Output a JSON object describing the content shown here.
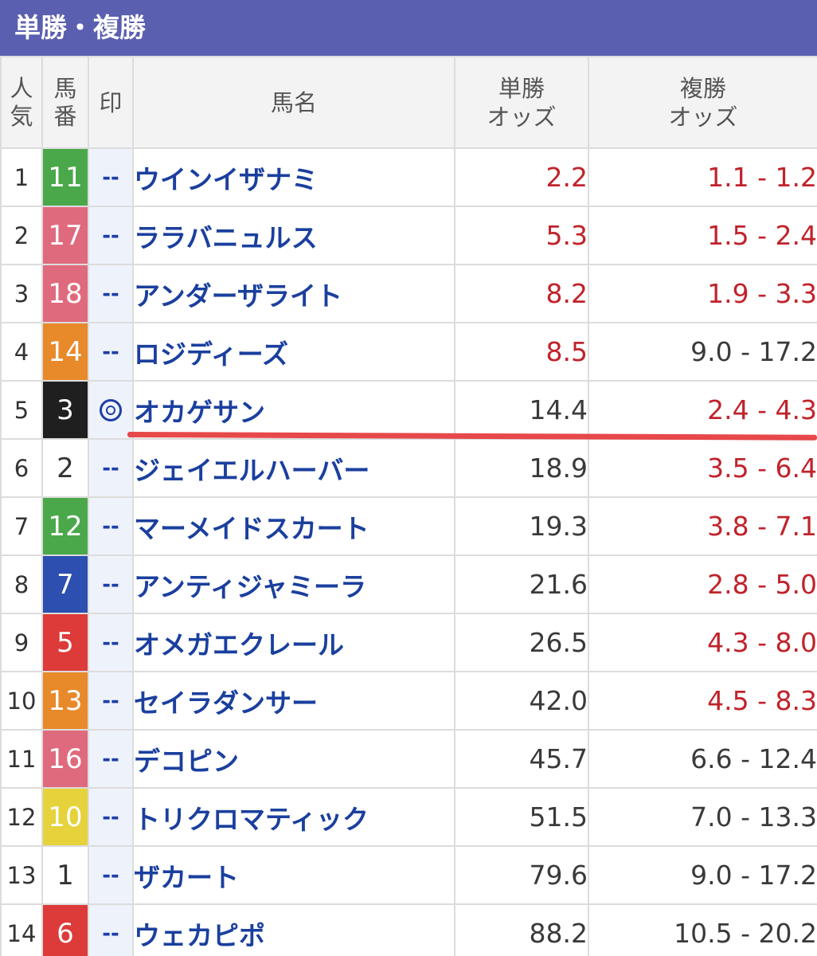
{
  "section_title": "単勝・複勝",
  "headers": {
    "rank": "人気",
    "number": "馬番",
    "mark": "印",
    "name": "馬名",
    "win_odds": [
      "単勝",
      "オッズ"
    ],
    "place_odds": [
      "複勝",
      "オッズ"
    ]
  },
  "rows": [
    {
      "rank": "1",
      "number": "11",
      "number_bg": "#4aa84a",
      "mark": "--",
      "name": "ウインイザナミ",
      "win": "2.2",
      "win_hot": true,
      "place": "1.1 - 1.2",
      "place_hot": true
    },
    {
      "rank": "2",
      "number": "17",
      "number_bg": "#e06a7d",
      "mark": "--",
      "name": "ララバニュルス",
      "win": "5.3",
      "win_hot": true,
      "place": "1.5 - 2.4",
      "place_hot": true
    },
    {
      "rank": "3",
      "number": "18",
      "number_bg": "#e06a7d",
      "mark": "--",
      "name": "アンダーザライト",
      "win": "8.2",
      "win_hot": true,
      "place": "1.9 - 3.3",
      "place_hot": true
    },
    {
      "rank": "4",
      "number": "14",
      "number_bg": "#e8892a",
      "mark": "--",
      "name": "ロジディーズ",
      "win": "8.5",
      "win_hot": true,
      "place": "9.0 - 17.2",
      "place_hot": false
    },
    {
      "rank": "5",
      "number": "3",
      "number_bg": "#1f1f1f",
      "mark": "◎",
      "name": "オカゲサン",
      "win": "14.4",
      "win_hot": false,
      "place": "2.4 - 4.3",
      "place_hot": true
    },
    {
      "rank": "6",
      "number": "2",
      "number_bg": "#ffffff",
      "mark": "--",
      "name": "ジェイエルハーバー",
      "win": "18.9",
      "win_hot": false,
      "place": "3.5 - 6.4",
      "place_hot": true
    },
    {
      "rank": "7",
      "number": "12",
      "number_bg": "#4aa84a",
      "mark": "--",
      "name": "マーメイドスカート",
      "win": "19.3",
      "win_hot": false,
      "place": "3.8 - 7.1",
      "place_hot": true
    },
    {
      "rank": "8",
      "number": "7",
      "number_bg": "#2c4fb0",
      "mark": "--",
      "name": "アンティジャミーラ",
      "win": "21.6",
      "win_hot": false,
      "place": "2.8 - 5.0",
      "place_hot": true
    },
    {
      "rank": "9",
      "number": "5",
      "number_bg": "#dd3a3a",
      "mark": "--",
      "name": "オメガエクレール",
      "win": "26.5",
      "win_hot": false,
      "place": "4.3 - 8.0",
      "place_hot": true
    },
    {
      "rank": "10",
      "number": "13",
      "number_bg": "#e8892a",
      "mark": "--",
      "name": "セイラダンサー",
      "win": "42.0",
      "win_hot": false,
      "place": "4.5 - 8.3",
      "place_hot": true
    },
    {
      "rank": "11",
      "number": "16",
      "number_bg": "#e06a7d",
      "mark": "--",
      "name": "デコピン",
      "win": "45.7",
      "win_hot": false,
      "place": "6.6 - 12.4",
      "place_hot": false
    },
    {
      "rank": "12",
      "number": "10",
      "number_bg": "#e6d23a",
      "mark": "--",
      "name": "トリクロマティック",
      "win": "51.5",
      "win_hot": false,
      "place": "7.0 - 13.3",
      "place_hot": false
    },
    {
      "rank": "13",
      "number": "1",
      "number_bg": "#ffffff",
      "mark": "--",
      "name": "ザカート",
      "win": "79.6",
      "win_hot": false,
      "place": "9.0 - 17.2",
      "place_hot": false
    },
    {
      "rank": "14",
      "number": "6",
      "number_bg": "#dd3a3a",
      "mark": "--",
      "name": "ウェカピポ",
      "win": "88.2",
      "win_hot": false,
      "place": "10.5 - 20.2",
      "place_hot": false
    }
  ],
  "colors": {
    "title_bar": "#5b5fb0",
    "hot_odds": "#c0232b",
    "horse_name": "#1a3f9e",
    "annotation_line": "#e5383b"
  }
}
